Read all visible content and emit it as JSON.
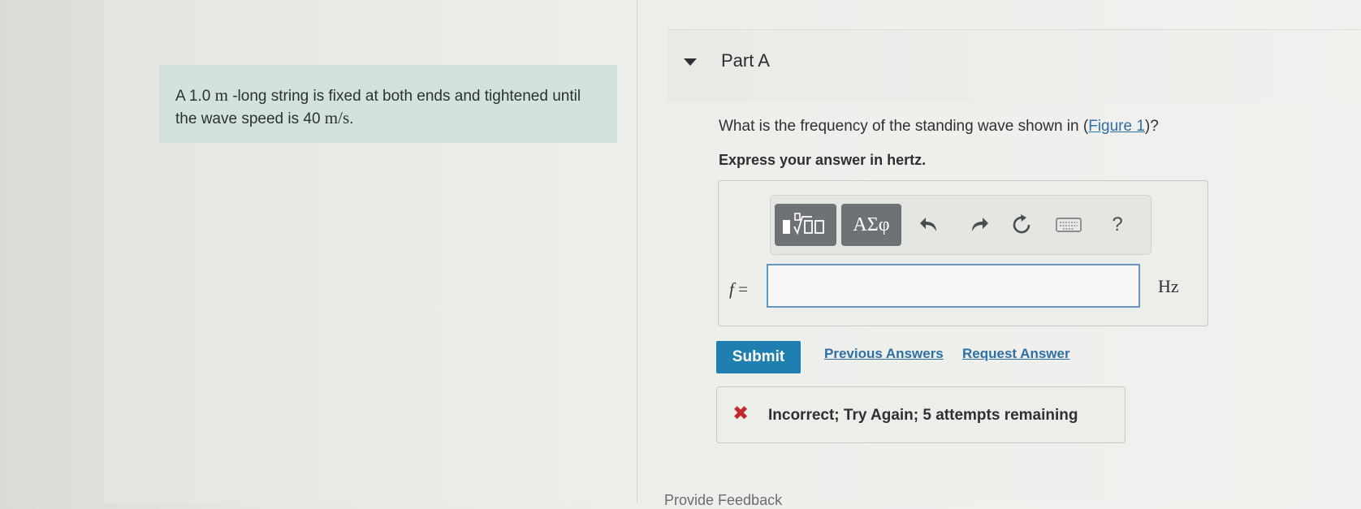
{
  "problem": {
    "text_1": "A 1.0 ",
    "unit_1": "m",
    "text_2": " -long string is fixed at both ends and tightened until the wave speed is 40 ",
    "unit_2": "m/s",
    "text_3": "."
  },
  "part": {
    "title": "Part A",
    "question_prefix": "What is the frequency of the standing wave shown in (",
    "figure_link": "Figure 1",
    "question_suffix": ")?",
    "instruction": "Express your answer in hertz."
  },
  "toolbar": {
    "greek_label": "ΑΣφ",
    "help_label": "?"
  },
  "answer": {
    "variable": "f",
    "equals": " =",
    "value": "",
    "unit": "Hz"
  },
  "actions": {
    "submit_label": "Submit",
    "previous_answers_label": "Previous Answers",
    "request_answer_label": "Request Answer"
  },
  "feedback": {
    "message": "Incorrect; Try Again; 5 attempts remaining",
    "status_color": "#c42a2a"
  },
  "footer": {
    "provide_feedback_label": "Provide Feedback"
  }
}
